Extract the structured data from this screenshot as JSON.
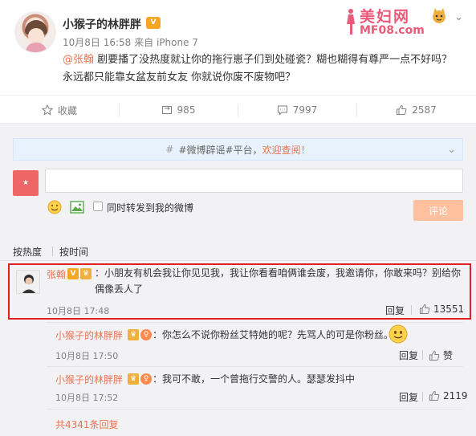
{
  "post": {
    "author": "小猴子的林胖胖",
    "time": "10月8日 16:58",
    "source": "来自 iPhone 7",
    "mention": "@张翰",
    "text": " 剧要播了没热度就让你的拖行崽子们到处碰瓷？糊也糊得有尊严一点不好吗？永远都只能靠女盆友前女友 你就说你废不废物吧？"
  },
  "watermark": {
    "title": "美妇网",
    "site": "MF08.com"
  },
  "actions": {
    "favorite": "收藏",
    "repost": "985",
    "comment": "7997",
    "like": "2587"
  },
  "notice": {
    "prefix": "#微博辟谣#平台，",
    "welcome": "欢迎查阅！"
  },
  "composer": {
    "input_value": "",
    "repost_label": "同时转发到我的微博",
    "submit": "评论"
  },
  "sort": {
    "hot": "按热度",
    "time": "按时间"
  },
  "comments": [
    {
      "name": "张翰",
      "text": "小朋友有机会我让你见见我，我让你看看咱俩谁会废，我邀请你，你敢来吗？别给你偶像丢人了",
      "time": "10月8日 17:48",
      "reply": "回复",
      "likes": "13551"
    }
  ],
  "replies": [
    {
      "name": "小猴子的林胖胖",
      "text": "：你怎么不说你粉丝艾特她的呢？先骂人的可是你粉丝。",
      "time": "10月8日 17:50",
      "reply": "回复",
      "likes": "赞"
    },
    {
      "name": "小猴子的林胖胖",
      "text": "：我可不敢，一个曾拖行交警的人。瑟瑟发抖中",
      "time": "10月8日 17:52",
      "reply": "回复",
      "likes": "2119"
    }
  ],
  "more_replies": "共4341条回复",
  "colors": {
    "accent": "#eb7350",
    "highlight": "#e02020",
    "button": "#ffc09f"
  }
}
